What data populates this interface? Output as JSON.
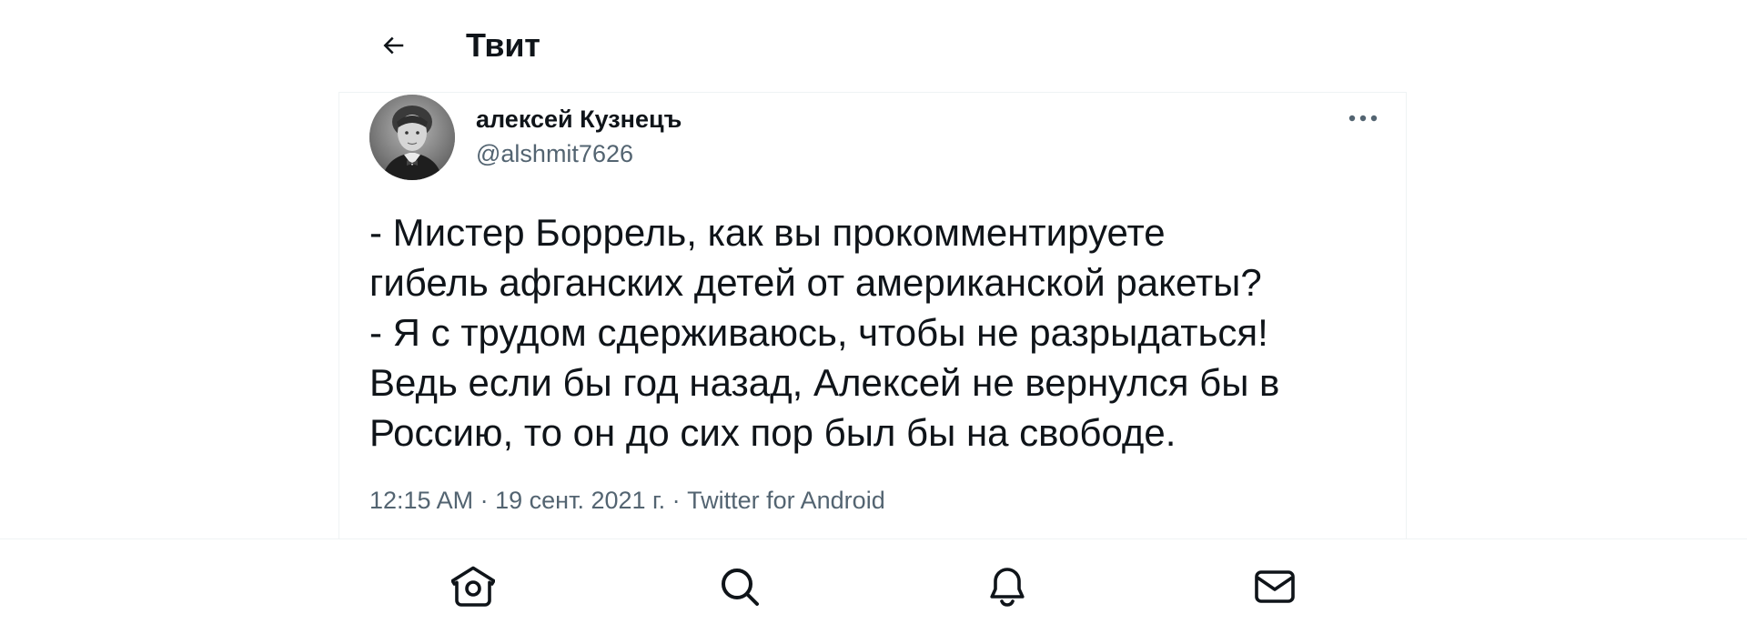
{
  "header": {
    "title": "Твит",
    "back_icon": "arrow-left-icon"
  },
  "tweet": {
    "author_name": "алексей Кузнецъ",
    "author_handle": "@alshmit7626",
    "text": "- Мистер Боррель, как вы прокомментируете\nгибель афганских детей от американской ракеты?\n- Я с трудом сдерживаюсь, чтобы не разрыдаться!\nВедь если бы год назад, Алексей не вернулся бы в\nРоссию, то он до сих пор был бы на свободе.",
    "time": "12:15 AM",
    "separator": "·",
    "date": "19 сент. 2021 г.",
    "source": "Twitter for Android",
    "more_icon": "more-horizontal-icon"
  },
  "bottom_nav": {
    "items": [
      {
        "name": "home",
        "icon": "home-icon"
      },
      {
        "name": "search",
        "icon": "search-icon"
      },
      {
        "name": "notifications",
        "icon": "bell-icon"
      },
      {
        "name": "messages",
        "icon": "mail-icon"
      }
    ]
  },
  "colors": {
    "text_primary": "#0f1419",
    "text_secondary": "#536471",
    "border": "#eff3f4"
  }
}
